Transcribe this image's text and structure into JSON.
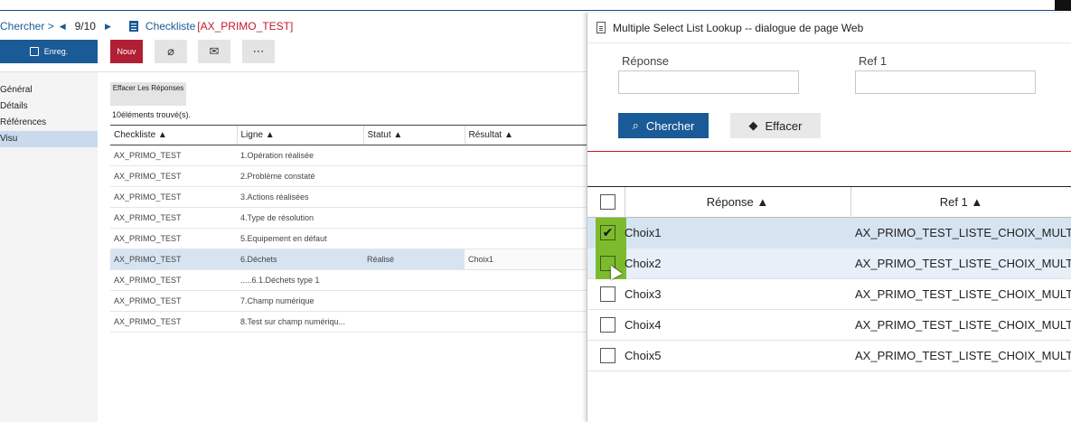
{
  "nav": {
    "search_label": "Chercher >",
    "position": "9/10",
    "record_title": "Checkliste",
    "record_id": "[AX_PRIMO_TEST]"
  },
  "toolbar": {
    "save_label": "Enreg.",
    "new_label": "Nouv",
    "attach_icon": "paperclip-icon",
    "mail_icon": "envelope-icon",
    "more_label": "⋯"
  },
  "sidebar": {
    "items": [
      {
        "label": "Général"
      },
      {
        "label": "Détails"
      },
      {
        "label": "Références"
      },
      {
        "label": "Visu"
      }
    ]
  },
  "main": {
    "clear_answers_label": "Effacer Les Réponses",
    "found_text": "10éléments trouvé(s).",
    "columns": [
      "Checkliste ▲",
      "Ligne ▲",
      "Statut ▲",
      "Résultat ▲"
    ],
    "rows": [
      {
        "checkliste": "AX_PRIMO_TEST",
        "ligne": "1.Opération réalisée",
        "statut": "",
        "resultat": ""
      },
      {
        "checkliste": "AX_PRIMO_TEST",
        "ligne": "2.Problème constaté",
        "statut": "",
        "resultat": ""
      },
      {
        "checkliste": "AX_PRIMO_TEST",
        "ligne": "3.Actions réalisées",
        "statut": "",
        "resultat": ""
      },
      {
        "checkliste": "AX_PRIMO_TEST",
        "ligne": "4.Type de résolution",
        "statut": "",
        "resultat": ""
      },
      {
        "checkliste": "AX_PRIMO_TEST",
        "ligne": "5.Equipement en défaut",
        "statut": "",
        "resultat": ""
      },
      {
        "checkliste": "AX_PRIMO_TEST",
        "ligne": "6.Déchets",
        "statut": "Réalisé",
        "resultat": "Choix1"
      },
      {
        "checkliste": "AX_PRIMO_TEST",
        "ligne": ".....6.1.Déchets type 1",
        "statut": "",
        "resultat": ""
      },
      {
        "checkliste": "AX_PRIMO_TEST",
        "ligne": "7.Champ numérique",
        "statut": "",
        "resultat": ""
      },
      {
        "checkliste": "AX_PRIMO_TEST",
        "ligne": "8.Test sur champ numériqu...",
        "statut": "",
        "resultat": ""
      }
    ]
  },
  "dialog": {
    "title": "Multiple Select List Lookup -- dialogue de page Web",
    "field_reponse_label": "Réponse",
    "field_ref_label": "Ref 1",
    "field_reponse_value": "",
    "field_ref_value": "",
    "search_label": "Chercher",
    "erase_label": "Effacer",
    "columns": [
      "Réponse ▲",
      "Ref 1 ▲"
    ],
    "rows": [
      {
        "reponse": "Choix1",
        "ref": "AX_PRIMO_TEST_LISTE_CHOIX_MULT...",
        "checked": true
      },
      {
        "reponse": "Choix2",
        "ref": "AX_PRIMO_TEST_LISTE_CHOIX_MULT...",
        "checked": false
      },
      {
        "reponse": "Choix3",
        "ref": "AX_PRIMO_TEST_LISTE_CHOIX_MULT...",
        "checked": false
      },
      {
        "reponse": "Choix4",
        "ref": "AX_PRIMO_TEST_LISTE_CHOIX_MULT...",
        "checked": false
      },
      {
        "reponse": "Choix5",
        "ref": "AX_PRIMO_TEST_LISTE_CHOIX_MULT...",
        "checked": false
      }
    ]
  },
  "colors": {
    "primary": "#1a5a96",
    "accent_red": "#b11f35",
    "selection": "#d6e4f2",
    "checkbox_highlight": "#7dbb2e"
  }
}
